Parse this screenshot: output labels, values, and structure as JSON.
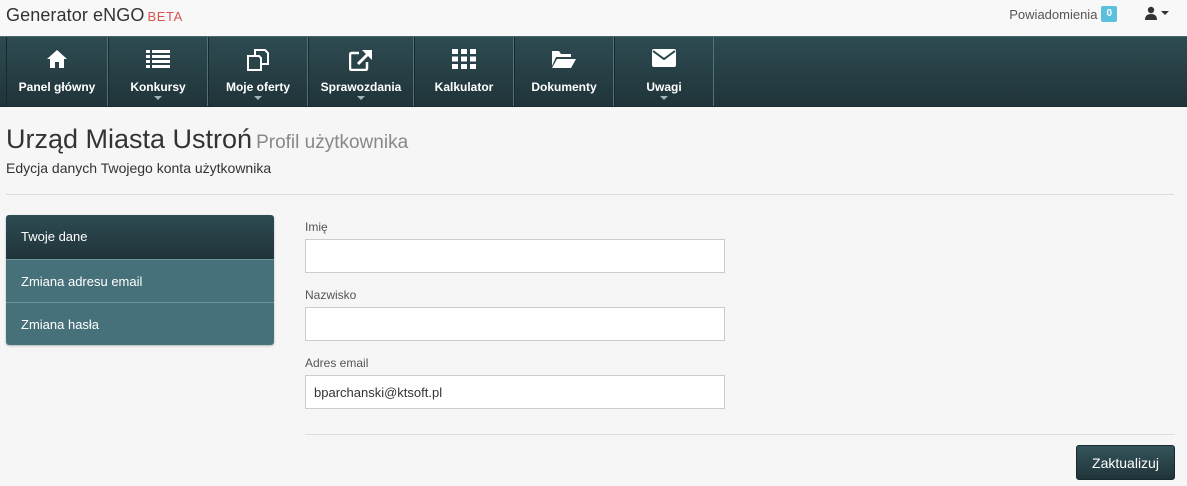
{
  "app": {
    "title": "Generator eNGO",
    "beta": "BETA"
  },
  "topbar": {
    "notifications_label": "Powiadomienia",
    "notifications_count": "0"
  },
  "nav": {
    "items": [
      {
        "label": "Panel główny",
        "icon": "home-icon"
      },
      {
        "label": "Konkursy",
        "icon": "list-icon",
        "dropdown": true
      },
      {
        "label": "Moje oferty",
        "icon": "copy-icon",
        "dropdown": true
      },
      {
        "label": "Sprawozdania",
        "icon": "external-link-icon",
        "dropdown": true
      },
      {
        "label": "Kalkulator",
        "icon": "grid-icon"
      },
      {
        "label": "Dokumenty",
        "icon": "folder-open-icon"
      },
      {
        "label": "Uwagi",
        "icon": "envelope-icon",
        "dropdown": true
      }
    ]
  },
  "page": {
    "title": "Urząd Miasta Ustroń",
    "subtitle": "Profil użytkownika",
    "description": "Edycja danych Twojego konta użytkownika"
  },
  "sidenav": {
    "items": [
      {
        "label": "Twoje dane",
        "active": true
      },
      {
        "label": "Zmiana adresu email"
      },
      {
        "label": "Zmiana hasła"
      }
    ]
  },
  "form": {
    "first_name": {
      "label": "Imię",
      "value": ""
    },
    "last_name": {
      "label": "Nazwisko",
      "value": ""
    },
    "email": {
      "label": "Adres email",
      "value": "bparchanski@ktsoft.pl"
    },
    "submit_label": "Zaktualizuj"
  },
  "colors": {
    "accent": "#2a444a",
    "sidenav": "#46707a",
    "badge": "#5bc0de",
    "beta": "#d9534f"
  }
}
